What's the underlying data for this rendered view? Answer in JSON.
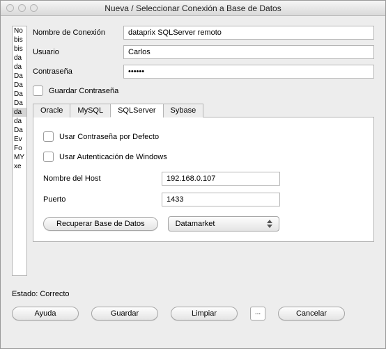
{
  "window": {
    "title": "Nueva / Seleccionar Conexión a Base de Datos"
  },
  "sidebar": {
    "items": [
      "No",
      "bis",
      "bis",
      "da",
      "da",
      "Da",
      "Da",
      "Da",
      "Da",
      "da",
      "da",
      "Da",
      "Ev",
      "Fo",
      "MY",
      "xe"
    ],
    "selected_index": 9
  },
  "form": {
    "connection_name_label": "Nombre de Conexión",
    "connection_name_value": "dataprix SQLServer remoto",
    "user_label": "Usuario",
    "user_value": "Carlos",
    "password_label": "Contraseña",
    "password_value": "••••••",
    "save_password_label": "Guardar Contraseña"
  },
  "tabs": {
    "items": [
      "Oracle",
      "MySQL",
      "SQLServer",
      "Sybase"
    ],
    "active_index": 2
  },
  "sqlserver": {
    "default_password_label": "Usar Contraseña por Defecto",
    "windows_auth_label": "Usar Autenticación de Windows",
    "host_label": "Nombre del Host",
    "host_value": "192.168.0.107",
    "port_label": "Puerto",
    "port_value": "1433",
    "retrieve_db_label": "Recuperar Base de Datos",
    "database_value": "Datamarket"
  },
  "status": {
    "text": "Estado: Correcto"
  },
  "footer": {
    "help": "Ayuda",
    "save": "Guardar",
    "clear": "Limpiar",
    "more": "...",
    "cancel": "Cancelar"
  }
}
